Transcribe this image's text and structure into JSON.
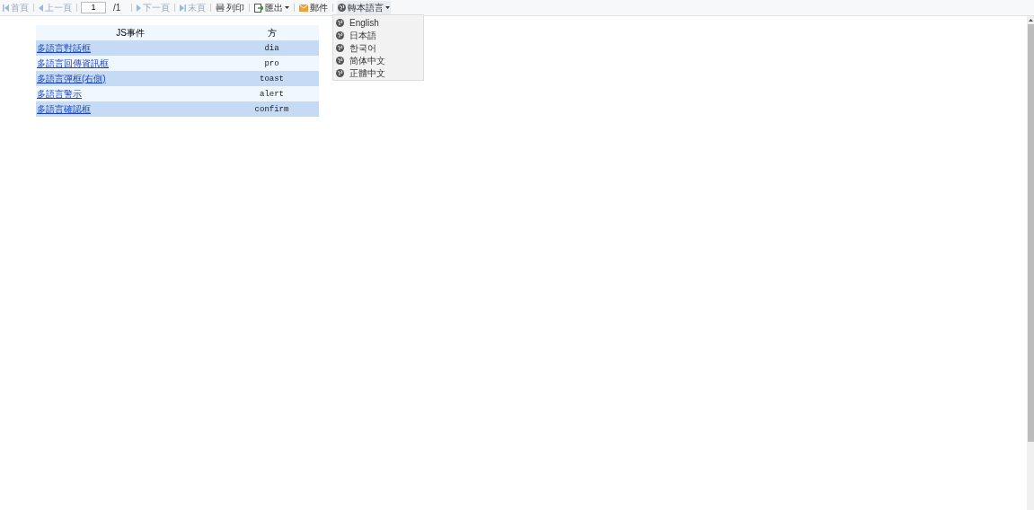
{
  "toolbar": {
    "items": [
      {
        "kind": "nav",
        "label": "首頁",
        "disabled": true
      },
      {
        "kind": "nav",
        "label": "上一頁",
        "disabled": true
      },
      {
        "kind": "page",
        "value": "1",
        "total": "/1"
      },
      {
        "kind": "nav",
        "label": "下一頁",
        "disabled": true
      },
      {
        "kind": "nav",
        "label": "末頁",
        "disabled": true
      },
      {
        "kind": "button",
        "label": "列印",
        "disabled": false
      },
      {
        "kind": "menu",
        "label": "匯出",
        "disabled": false
      },
      {
        "kind": "button",
        "label": "郵件",
        "disabled": false
      },
      {
        "kind": "menu",
        "label": "轉本語言",
        "disabled": false,
        "expanded": true
      }
    ]
  },
  "language_menu": {
    "items": [
      "English",
      "日本語",
      "한국어",
      "简体中文",
      "正體中文"
    ]
  },
  "table": {
    "columns": [
      "JS事件",
      "方"
    ],
    "rows": [
      {
        "event": "多語言對話框",
        "method": "dia"
      },
      {
        "event": "多語言回傳資訊框",
        "method": "pro"
      },
      {
        "event": "多語言彈框(右側)",
        "method": "toast"
      },
      {
        "event": "多語言警示",
        "method": "alert"
      },
      {
        "event": "多語言確認框",
        "method": "confirm"
      }
    ]
  }
}
